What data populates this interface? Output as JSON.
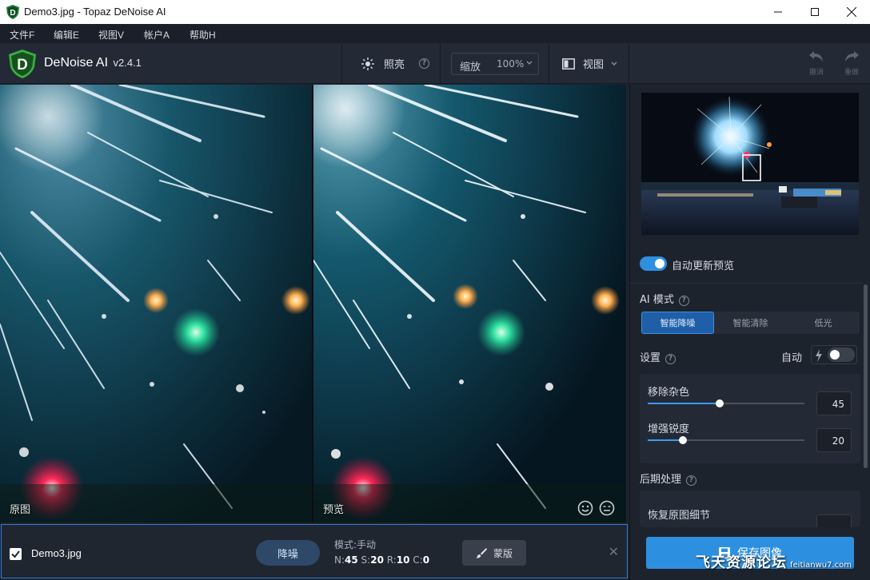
{
  "window": {
    "title": "Demo3.jpg - Topaz DeNoise AI"
  },
  "menu": [
    "文件F",
    "编辑E",
    "视图V",
    "帐户A",
    "帮助H"
  ],
  "toolbar": {
    "app_name": "DeNoise AI",
    "version": "v2.4.1",
    "brightness_label": "照亮",
    "zoom_label": "缩放",
    "zoom_value": "100%",
    "view_label": "视图",
    "undo_label": "撤消",
    "redo_label": "重做"
  },
  "panes": {
    "original_label": "原图",
    "preview_label": "预览"
  },
  "file_bar": {
    "file_name": "Demo3.jpg",
    "checked": true,
    "denoise_button": "降噪",
    "mode_text": "模式:手动",
    "stats": {
      "N": "45",
      "S": "20",
      "R": "10",
      "C": "0"
    },
    "mask_button": "蒙版"
  },
  "right_panel": {
    "auto_update_label": "自动更新预览",
    "auto_update_on": true,
    "ai_mode_title": "AI 模式",
    "ai_modes": [
      "智能降噪",
      "智能清除",
      "低光"
    ],
    "ai_mode_selected": "智能降噪",
    "settings_title": "设置",
    "auto_label": "自动",
    "auto_on": false,
    "sliders": [
      {
        "label": "移除杂色",
        "value": 45
      },
      {
        "label": "增强锐度",
        "value": 20
      }
    ],
    "post_title": "后期处理",
    "restore_detail_label": "恢复原图细节",
    "save_button": "保存图像"
  },
  "watermark": {
    "text": "飞天资源论坛",
    "url": "feitianwu7.com"
  },
  "colors": {
    "accent": "#2d8fe0",
    "panel_bg": "#1d232d",
    "toolbar_bg": "#232a36"
  }
}
